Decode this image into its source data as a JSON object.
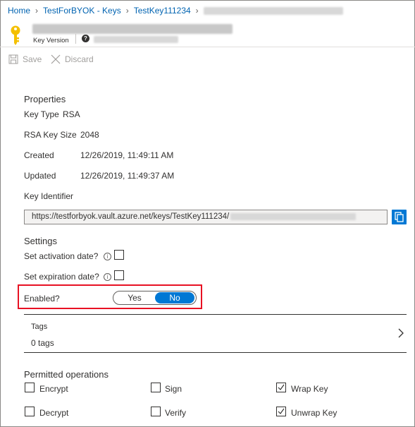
{
  "breadcrumb": {
    "items": [
      "Home",
      "TestForBYOK - Keys",
      "TestKey111234"
    ]
  },
  "header": {
    "subtitle": "Key Version",
    "info_icon": "info-icon"
  },
  "toolbar": {
    "save_label": "Save",
    "discard_label": "Discard"
  },
  "properties": {
    "heading": "Properties",
    "key_type_label": "Key Type",
    "key_type_value": "RSA",
    "key_size_label": "RSA Key Size",
    "key_size_value": "2048",
    "created_label": "Created",
    "created_value": "12/26/2019, 11:49:11 AM",
    "updated_label": "Updated",
    "updated_value": "12/26/2019, 11:49:37 AM",
    "identifier_label": "Key Identifier",
    "identifier_value": "https://testforbyok.vault.azure.net/keys/TestKey111234/"
  },
  "settings": {
    "heading": "Settings",
    "activation_label": "Set activation date?",
    "activation_checked": false,
    "expiration_label": "Set expiration date?",
    "expiration_checked": false,
    "enabled_label": "Enabled?",
    "enabled_yes": "Yes",
    "enabled_no": "No",
    "enabled_selected": "No"
  },
  "tags": {
    "label": "Tags",
    "value": "0 tags"
  },
  "permitted": {
    "heading": "Permitted operations",
    "ops": [
      {
        "label": "Encrypt",
        "checked": false
      },
      {
        "label": "Sign",
        "checked": false
      },
      {
        "label": "Wrap Key",
        "checked": true
      },
      {
        "label": "Decrypt",
        "checked": false
      },
      {
        "label": "Verify",
        "checked": false
      },
      {
        "label": "Unwrap Key",
        "checked": true
      }
    ]
  },
  "colors": {
    "accent": "#0078d4",
    "link": "#0063b1",
    "highlight": "#e81123",
    "key_icon": "#f4c000"
  }
}
